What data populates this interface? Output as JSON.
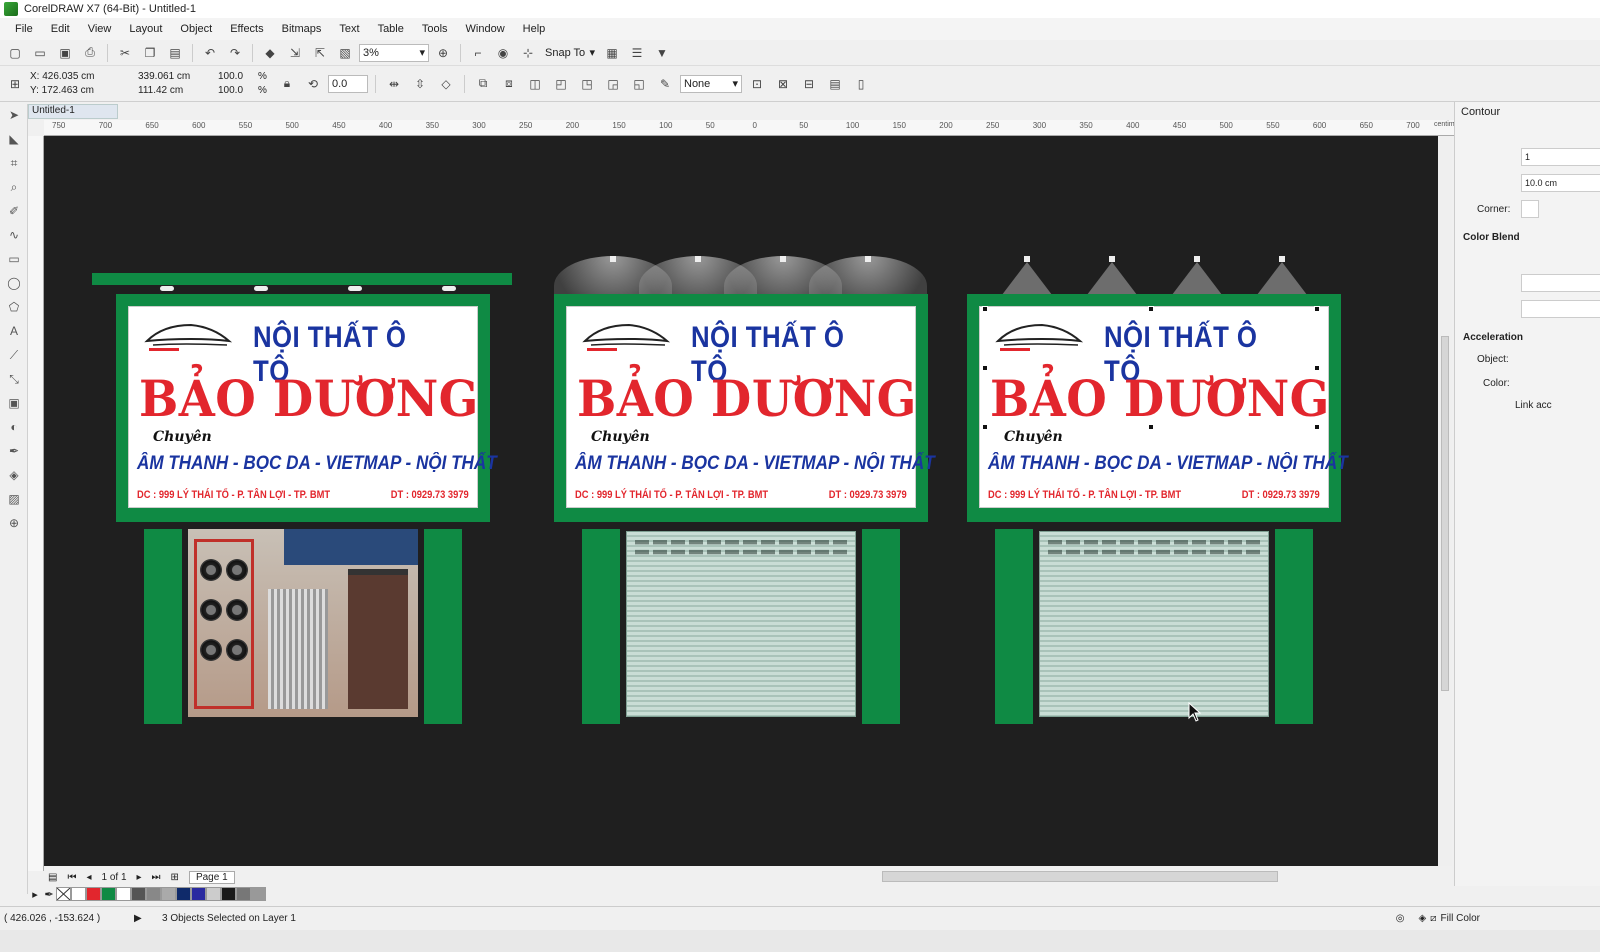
{
  "window": {
    "title": "CorelDRAW X7 (64-Bit) - Untitled-1"
  },
  "menu": [
    "File",
    "Edit",
    "View",
    "Layout",
    "Object",
    "Effects",
    "Bitmaps",
    "Text",
    "Table",
    "Tools",
    "Window",
    "Help"
  ],
  "toolbar": {
    "zoom": "3%",
    "snap_to": "Snap To"
  },
  "property_bar": {
    "x": "X: 426.035 cm",
    "y": "Y: 172.463 cm",
    "width": "339.061 cm",
    "height": "111.42 cm",
    "scale_w": "100.0",
    "scale_h": "100.0",
    "percent": "%",
    "rotation": "0.0",
    "outline": "None"
  },
  "document_tab": "Untitled-1",
  "ruler_labels": [
    "750",
    "700",
    "650",
    "600",
    "550",
    "500",
    "450",
    "400",
    "350",
    "300",
    "250",
    "200",
    "150",
    "100",
    "50",
    "0",
    "50",
    "100",
    "150",
    "200",
    "250",
    "300",
    "350",
    "400",
    "450",
    "500",
    "550",
    "600",
    "650",
    "700",
    "750"
  ],
  "ruler_units": "centimeters",
  "sign": {
    "top_line": "NỘI THẤT Ô TÔ",
    "main_line": "BẢO DƯƠNG",
    "chuyen": "Chuyên",
    "services": "ÂM THANH - BỌC DA - VIETMAP - NỘI THẤT",
    "address": "DC : 999 LÝ THÁI TỔ - P. TÂN LỢI - TP. BMT",
    "phone": "DT : 0929.73 3979"
  },
  "right_panel": {
    "title": "Contour",
    "steps": "1",
    "offset": "10.0 cm",
    "corner": "Corner:",
    "color_blend": "Color Blend",
    "acceleration": "Acceleration",
    "object": "Object:",
    "color": "Color:",
    "link": "Link acc"
  },
  "page_nav": {
    "count": "1 of 1",
    "page": "Page 1"
  },
  "palette": [
    "#ffffff",
    "#e2262d",
    "#0f8a44",
    "#ffffff",
    "#555555",
    "#888888",
    "#aaaaaa",
    "#0f2a6a",
    "#2a2aa0",
    "#cccccc",
    "#1a1a1a",
    "#777777",
    "#999999"
  ],
  "status": {
    "coords": "( 426.026 , -153.624 )",
    "selection": "3 Objects Selected on Layer 1",
    "fill": "Fill Color"
  }
}
